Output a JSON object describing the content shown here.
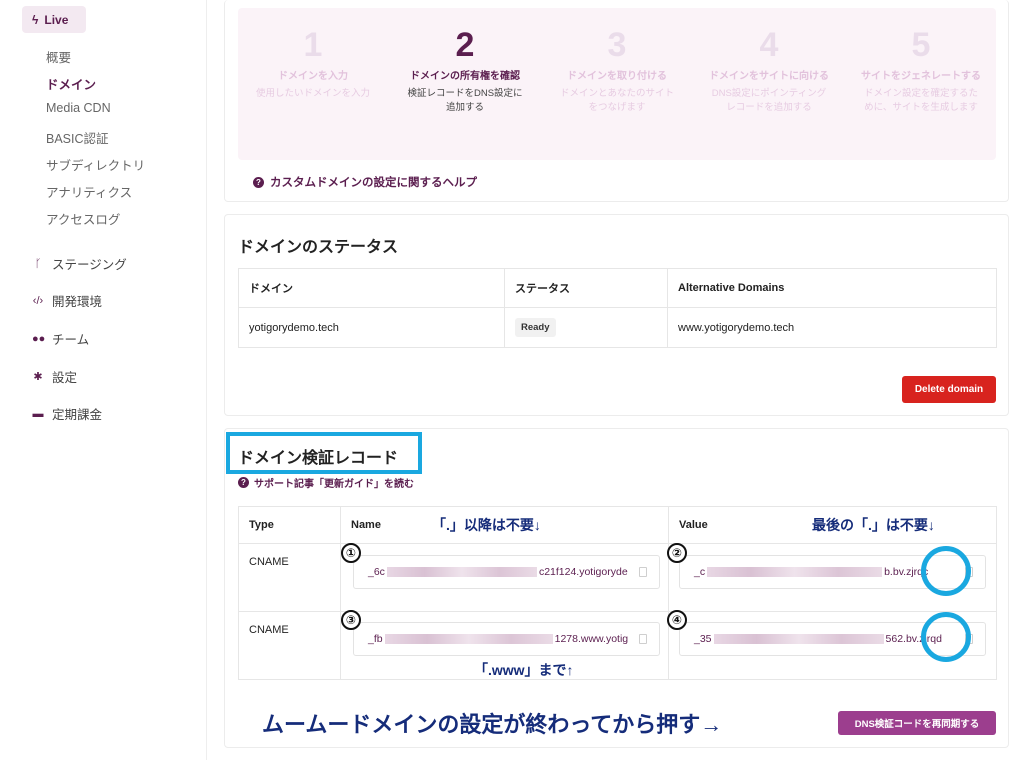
{
  "sidebar": {
    "live_label": "Live",
    "sub_items": [
      "概要",
      "ドメイン",
      "Media CDN",
      "BASIC認証",
      "サブディレクトリ",
      "アナリティクス",
      "アクセスログ"
    ],
    "nav_items": [
      {
        "label": "ステージング",
        "icon": "branch-icon"
      },
      {
        "label": "開発環境",
        "icon": "code-icon"
      },
      {
        "label": "チーム",
        "icon": "team-icon"
      },
      {
        "label": "設定",
        "icon": "gear-icon"
      },
      {
        "label": "定期課金",
        "icon": "card-icon"
      }
    ]
  },
  "steps": [
    {
      "num": "1",
      "title": "ドメインを入力",
      "desc": "使用したいドメインを入力"
    },
    {
      "num": "2",
      "title": "ドメインの所有権を確認",
      "desc": "検証レコードをDNS設定に追加する"
    },
    {
      "num": "3",
      "title": "ドメインを取り付ける",
      "desc": "ドメインとあなたのサイトをつなげます"
    },
    {
      "num": "4",
      "title": "ドメインをサイトに向ける",
      "desc": "DNS設定にポインティングレコードを追加する"
    },
    {
      "num": "5",
      "title": "サイトをジェネレートする",
      "desc": "ドメイン設定を確定するために、サイトを生成します"
    }
  ],
  "help_link": "カスタムドメインの設定に関するヘルプ",
  "status": {
    "title": "ドメインのステータス",
    "headers": [
      "ドメイン",
      "ステータス",
      "Alternative Domains"
    ],
    "row": {
      "domain": "yotigorydemo.tech",
      "status": "Ready",
      "alt": "www.yotigorydemo.tech"
    },
    "delete_label": "Delete domain"
  },
  "verify": {
    "title": "ドメイン検証レコード",
    "support_link": "サポート記事「更新ガイド」を読む",
    "headers": {
      "type": "Type",
      "name": "Name",
      "value": "Value"
    },
    "rows": [
      {
        "type": "CNAME",
        "name_start": "_6c",
        "name_end": "c21f124.yotigoryde",
        "value_start": "_c",
        "value_end": "b.bv.zjrqc"
      },
      {
        "type": "CNAME",
        "name_start": "_fb",
        "name_end": "1278.www.yotig",
        "value_start": "_35",
        "value_end": "562.bv.zjrqd"
      }
    ],
    "resync_label": "DNS検証コードを再同期する"
  },
  "annotations": {
    "name_note": "「.」以降は不要↓",
    "value_note": "最後の「.」は不要↓",
    "www_note": "「.www」まで↑",
    "bottom_note": "ムームードメインの設定が終わってから押す→",
    "markers": [
      "①",
      "②",
      "③",
      "④"
    ]
  },
  "colors": {
    "brand": "#5b1e4f",
    "danger": "#d8231e",
    "highlight": "#1aa8e0",
    "annotation": "#152c7a",
    "resync": "#9c3e8e"
  }
}
